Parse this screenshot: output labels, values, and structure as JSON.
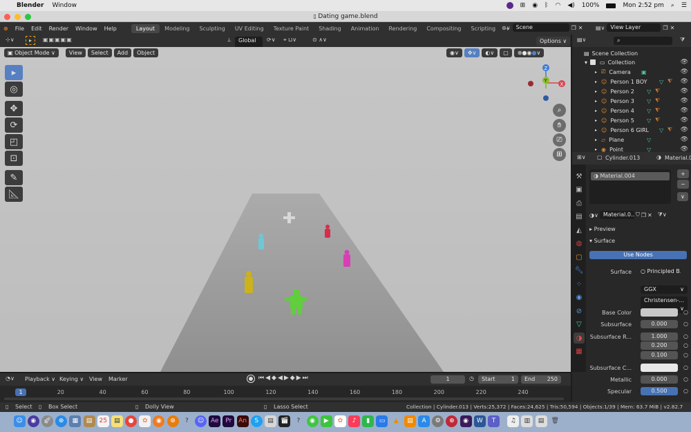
{
  "macbar": {
    "apple": "",
    "app_name": "Blender",
    "menu_window": "Window",
    "battery": "100%",
    "time": "Mon 2:52 pm"
  },
  "window": {
    "title": "Dating game.blend"
  },
  "topbar": {
    "menus": [
      "File",
      "Edit",
      "Render",
      "Window",
      "Help"
    ],
    "workspaces": [
      "Layout",
      "Modeling",
      "Sculpting",
      "UV Editing",
      "Texture Paint",
      "Shading",
      "Animation",
      "Rendering",
      "Compositing",
      "Scripting"
    ],
    "active_workspace": "Layout",
    "add_tab": "+",
    "scene": "Scene",
    "view_layer": "View Layer"
  },
  "viewport_header": {
    "transform": "Global",
    "options": "Options"
  },
  "viewport_menu": {
    "mode": "Object Mode",
    "view": "View",
    "select": "Select",
    "add": "Add",
    "object": "Object"
  },
  "gizmo": {
    "x": "X",
    "y": "Y",
    "z": "Z"
  },
  "outliner": {
    "root": "Scene Collection",
    "collection": "Collection",
    "items": [
      "Camera",
      "Person 1 BOY",
      "Person 2",
      "Person 3",
      "Person 4",
      "Person 5",
      "Person 6 GIRL",
      "Plane",
      "Point"
    ]
  },
  "properties": {
    "object": "Cylinder.013",
    "material_header": "Material.0",
    "slot": "Material.004",
    "material_field": "Material.0..",
    "preview": "Preview",
    "surface_panel": "Surface",
    "use_nodes": "Use Nodes",
    "surface_label": "Surface",
    "surface_value": "Principled B...",
    "distribution": "GGX",
    "subsurface_method": "Christensen-...",
    "rows": [
      {
        "label": "Base Color",
        "value": ""
      },
      {
        "label": "Subsurface",
        "value": "0.000"
      },
      {
        "label": "Subsurface R...",
        "value": "1.000"
      },
      {
        "label": "",
        "value": "0.200"
      },
      {
        "label": "",
        "value": "0.100"
      },
      {
        "label": "Subsurface C...",
        "value": ""
      },
      {
        "label": "Metallic",
        "value": "0.000"
      },
      {
        "label": "Specular",
        "value": "0.500"
      }
    ]
  },
  "timeline": {
    "playback": "Playback",
    "keying": "Keying",
    "view": "View",
    "marker": "Marker",
    "current_frame": "1",
    "start_label": "Start",
    "start": "1",
    "end_label": "End",
    "end": "250",
    "ticks": [
      "1",
      "20",
      "40",
      "60",
      "80",
      "100",
      "120",
      "140",
      "160",
      "180",
      "200",
      "220",
      "240"
    ]
  },
  "statusbar": {
    "select": "Select",
    "box_select": "Box Select",
    "dolly": "Dolly View",
    "lasso": "Lasso Select",
    "stats": "Collection | Cylinder.013 | Verts:25,372 | Faces:24,625 | Tris:50,594 | Objects:1/39 | Mem: 63.7 MiB | v2.82.7"
  }
}
